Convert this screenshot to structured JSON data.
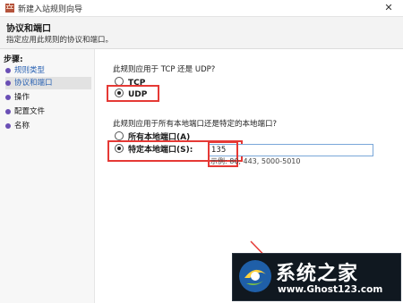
{
  "window": {
    "title": "新建入站规则向导",
    "close_glyph": "✕"
  },
  "header": {
    "title": "协议和端口",
    "subtitle": "指定应用此规则的协议和端口。"
  },
  "sidebar": {
    "steps_title": "步骤:",
    "items": [
      {
        "label": "规则类型"
      },
      {
        "label": "协议和端口"
      },
      {
        "label": "操作"
      },
      {
        "label": "配置文件"
      },
      {
        "label": "名称"
      }
    ]
  },
  "main": {
    "protocol_question": "此规则应用于 TCP 还是 UDP?",
    "protocol_options": [
      {
        "label": "TCP",
        "selected": false
      },
      {
        "label": "UDP",
        "selected": true
      }
    ],
    "port_question": "此规则应用于所有本地端口还是特定的本地端口?",
    "port_options": [
      {
        "label": "所有本地端口(A)",
        "selected": false
      },
      {
        "label": "特定本地端口(S):",
        "selected": true
      }
    ],
    "port_value": "135",
    "port_example": "示例: 80, 443, 5000-5010"
  },
  "watermark": {
    "text": "系统之家",
    "url": "www.Ghost123.com"
  },
  "colors": {
    "highlight": "#e53935",
    "accent": "#2a62b3",
    "dot": "#6a4fb5"
  }
}
